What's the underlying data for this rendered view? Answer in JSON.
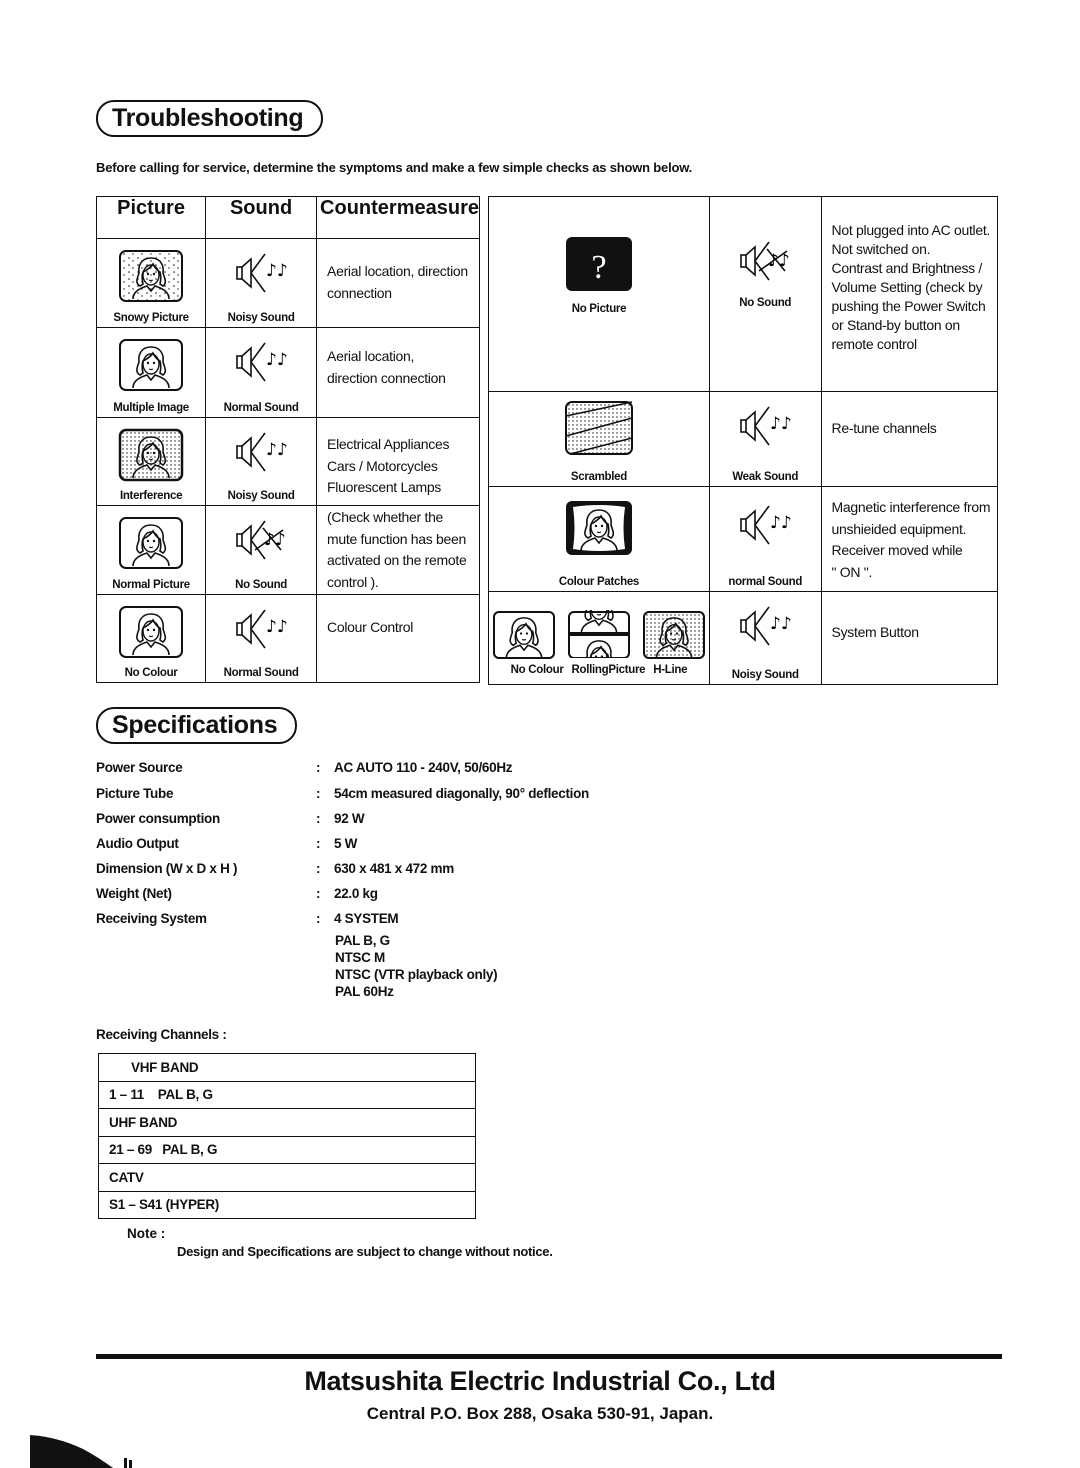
{
  "troubleshooting": {
    "title": "Troubleshooting",
    "intro": "Before calling for service, determine the symptoms and make a few simple checks as shown below.",
    "headers": {
      "picture": "Picture",
      "sound": "Sound",
      "countermeasure": "Countermeasure"
    },
    "left_rows": [
      {
        "picture": "Snowy Picture",
        "picture_icon": "tv-snowy-picture-icon",
        "sound": "Noisy Sound",
        "sound_icon": "speaker-sound-icon",
        "countermeasure": [
          "Aerial location, direction",
          "connection"
        ]
      },
      {
        "picture": "Multiple Image",
        "picture_icon": "tv-multiple-image-icon",
        "sound": "Normal Sound",
        "sound_icon": "speaker-sound-icon",
        "countermeasure": [
          "Aerial location,",
          "direction connection"
        ]
      },
      {
        "picture": "Interference",
        "picture_icon": "tv-interference-icon",
        "sound": "Noisy Sound",
        "sound_icon": "speaker-sound-icon",
        "countermeasure": [
          "Electrical Appliances",
          "Cars / Motorcycles",
          "Fluorescent Lamps"
        ]
      },
      {
        "picture": "Normal Picture",
        "picture_icon": "tv-normal-picture-icon",
        "sound": "No Sound",
        "sound_icon": "speaker-muted-icon",
        "countermeasure": [
          "(Check whether the",
          "mute function has been",
          "activated on the remote",
          "control )."
        ]
      },
      {
        "picture": "No Colour",
        "picture_icon": "tv-no-colour-icon",
        "sound": "Normal Sound",
        "sound_icon": "speaker-sound-icon",
        "countermeasure": [
          "Colour Control"
        ]
      }
    ],
    "right_rows": [
      {
        "pictures": [
          "No Picture"
        ],
        "picture_icon": "tv-no-picture-icon",
        "sound": "No Sound",
        "sound_icon": "speaker-muted-icon",
        "countermeasure": [
          "Not plugged into AC outlet.",
          "Not switched on.",
          "Contrast and Brightness /",
          "Volume Setting (check by",
          "pushing the Power Switch",
          "or Stand-by button on",
          "remote control"
        ]
      },
      {
        "pictures": [
          "Scrambled"
        ],
        "picture_icon": "tv-scrambled-icon",
        "sound": "Weak Sound",
        "sound_icon": "speaker-sound-icon",
        "countermeasure": [
          "Re-tune channels"
        ]
      },
      {
        "pictures": [
          "Colour Patches"
        ],
        "picture_icon": "tv-colour-patches-icon",
        "sound": "normal Sound",
        "sound_icon": "speaker-sound-icon",
        "countermeasure": [
          "Magnetic interference from",
          "unshieided equipment.",
          "Receiver moved while",
          "\" ON \"."
        ]
      },
      {
        "pictures": [
          "No Colour",
          "RollingPicture",
          "H-Line"
        ],
        "picture_icon": "tv-system-issues-icons",
        "sound": "Noisy Sound",
        "sound_icon": "speaker-sound-icon",
        "countermeasure": [
          "System Button"
        ]
      }
    ]
  },
  "specifications": {
    "title": "Specifications",
    "rows": [
      {
        "key": "Power Source",
        "value": "AC AUTO 110 - 240V, 50/60Hz"
      },
      {
        "key": "Picture Tube",
        "value": "54cm measured diagonally, 90° deflection"
      },
      {
        "key": "Power consumption",
        "value": "92 W"
      },
      {
        "key": "Audio Output",
        "value": "5 W"
      },
      {
        "key": "Dimension (W x D x H )",
        "value": "630 x 481 x 472 mm"
      },
      {
        "key": "Weight (Net)",
        "value": "22.0 kg"
      },
      {
        "key": "Receiving System",
        "value": "4 SYSTEM"
      }
    ],
    "separator": ":",
    "receiving_systems": [
      "PAL B, G",
      "NTSC M",
      "NTSC (VTR playback only)",
      "PAL 60Hz"
    ],
    "channels_label": "Receiving Channels :",
    "channels": [
      "VHF BAND",
      "1 – 11    PAL B, G",
      "UHF BAND",
      "21 – 69   PAL B, G",
      "CATV",
      "S1 – S41 (HYPER)"
    ],
    "note_label": "Note :",
    "note": "Design and Specifications are subject to change without notice."
  },
  "footer": {
    "company": "Matsushita Electric Industrial Co., Ltd",
    "address": "Central P.O. Box 288, Osaka 530-91, Japan."
  }
}
